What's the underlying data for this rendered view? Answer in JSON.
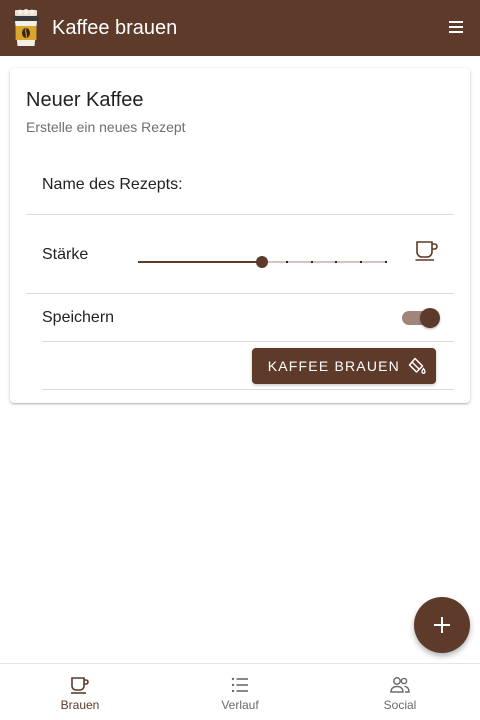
{
  "colors": {
    "primary": "#5d3a29",
    "on_primary": "#ffffff",
    "slider_inactive": "#d7c5bd",
    "toggle_track": "#a1857a",
    "inactive_nav": "#6b6b6b"
  },
  "app_bar": {
    "title": "Kaffee brauen",
    "logo_icon": "coffee-cup-logo-icon",
    "menu_icon": "hamburger-menu-icon"
  },
  "card": {
    "title": "Neuer Kaffee",
    "subtitle": "Erstelle ein neues Rezept",
    "name_field": {
      "placeholder": "Name des Rezepts:",
      "value": ""
    },
    "strength": {
      "label": "Stärke",
      "value": 0.5,
      "steps": 5,
      "icon": "coffee-cup-icon"
    },
    "save": {
      "label": "Speichern",
      "checked": true
    },
    "brew_button": {
      "label": "KAFFEE BRAUEN",
      "icon": "paint-bucket-icon"
    }
  },
  "fab": {
    "icon": "plus-icon"
  },
  "bottom_nav": {
    "items": [
      {
        "label": "Brauen",
        "icon": "coffee-cup-icon",
        "active": true
      },
      {
        "label": "Verlauf",
        "icon": "list-icon",
        "active": false
      },
      {
        "label": "Social",
        "icon": "people-icon",
        "active": false
      }
    ]
  }
}
